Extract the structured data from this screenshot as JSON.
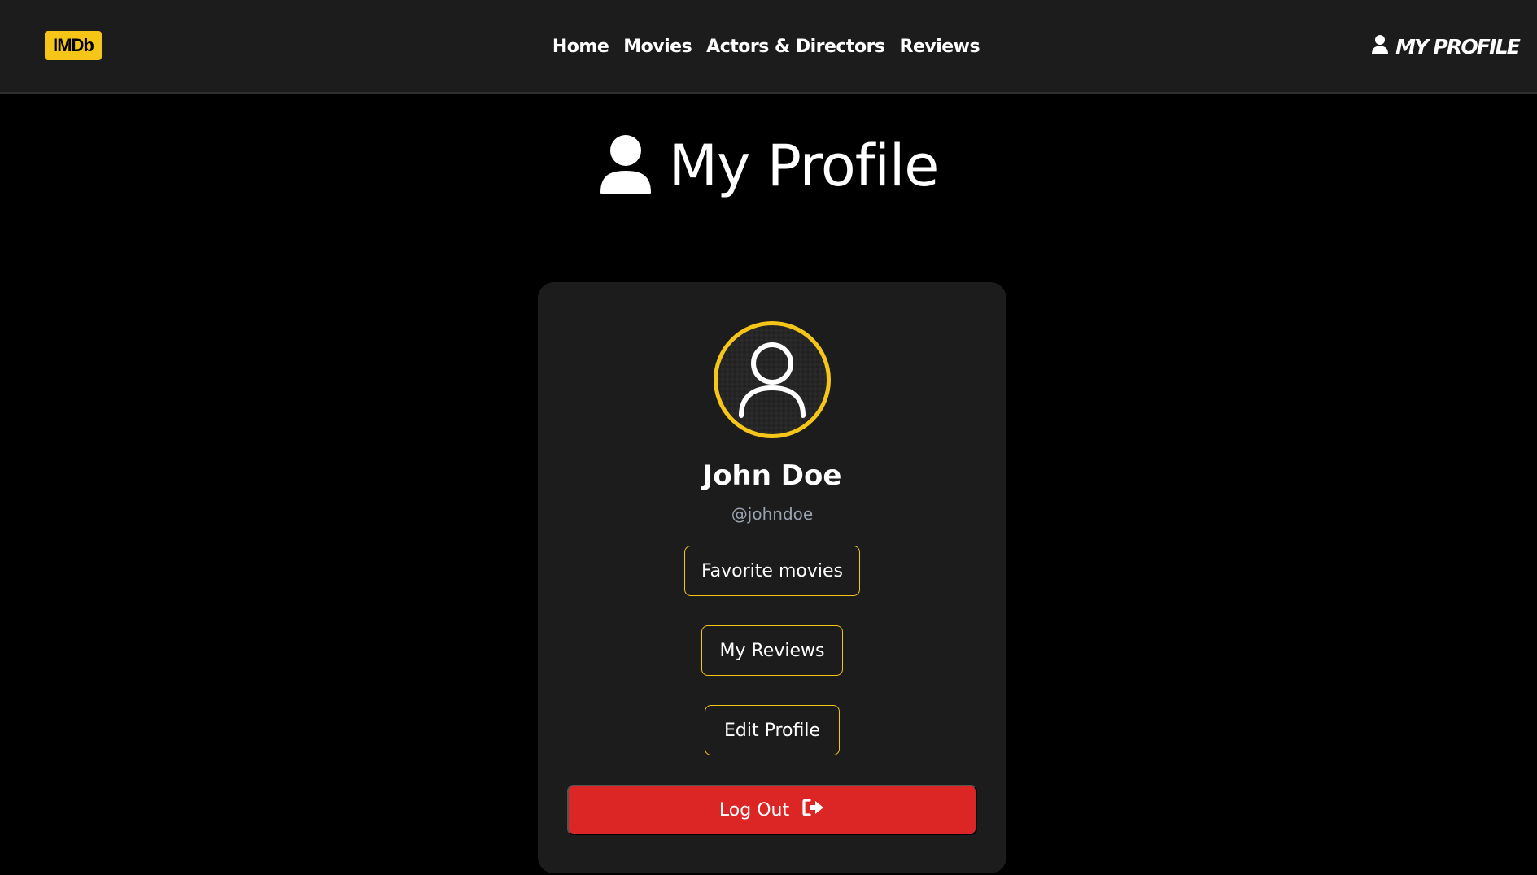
{
  "navbar": {
    "logo_text": "IMDb",
    "links": [
      "Home",
      "Movies",
      "Actors & Directors",
      "Reviews"
    ],
    "profile_label": "MY PROFILE"
  },
  "page": {
    "title": "My Profile"
  },
  "profile": {
    "name": "John Doe",
    "handle": "@johndoe",
    "buttons": {
      "favorites": "Favorite movies",
      "reviews": "My Reviews",
      "edit": "Edit Profile",
      "logout": "Log Out"
    }
  },
  "icons": {
    "nav_profile": "user-icon",
    "heading": "user-icon",
    "avatar": "user-outline-icon",
    "logout": "sign-out-icon"
  },
  "colors": {
    "accent": "#f5c518",
    "navbar_bg": "#1c1c1c",
    "card_bg": "#1c1c1c",
    "page_bg": "#000000",
    "logout_bg": "#dc2626",
    "handle_text": "#9aa3b0"
  }
}
